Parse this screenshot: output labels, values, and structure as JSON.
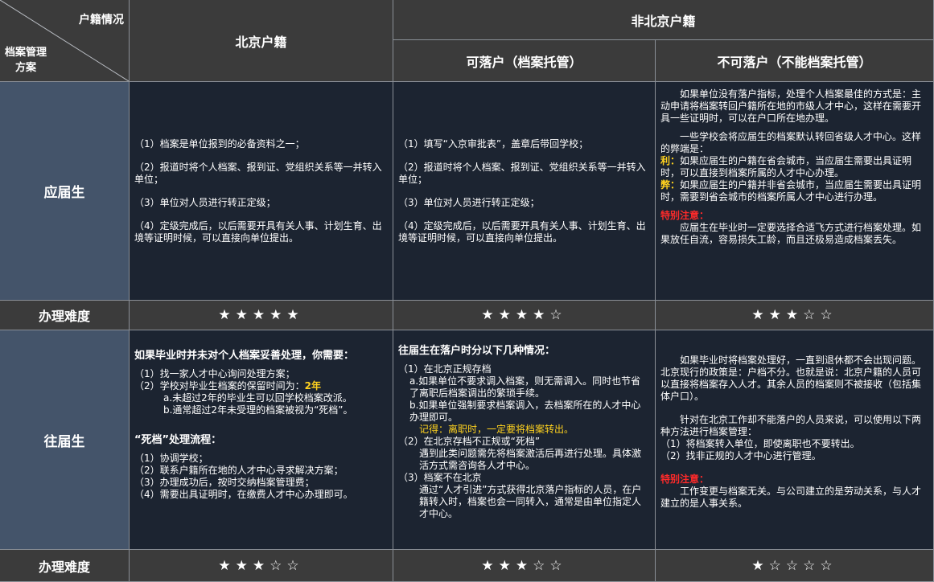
{
  "header": {
    "corner_top": "户籍情况",
    "corner_bottom": [
      "档案管理",
      "方案"
    ],
    "beijing": "北京户籍",
    "non_beijing": "非北京户籍",
    "settle": "可落户（档案托管）",
    "no_settle": "不可落户（不能档案托管）"
  },
  "rows": {
    "fresh_label": "应届生",
    "past_label": "往届生",
    "difficulty_label": "办理难度"
  },
  "fresh": {
    "beijing": [
      "（1）档案是单位报到的必备资料之一；",
      "（2）报道时将个人档案、报到证、党组织关系等一并转入单位；",
      "（3）单位对人员进行转正定级；",
      "（4）定级完成后，以后需要开具有关人事、计划生育、出境等证明时候，可以直接向单位提出。"
    ],
    "settle": [
      "（1）填写“入京审批表”，盖章后带回学校；",
      "（2）报道时将个人档案、报到证、党组织关系等一并转入单位；",
      "（3）单位对人员进行转正定级；",
      "（4）定级完成后，以后需要开具有关人事、计划生育、出境等证明时候，可以直接向单位提出。"
    ],
    "no_settle": {
      "p1": "如果单位没有落户指标，处理个人档案最佳的方式是：主动申请将档案转回户籍所在地的市级人才中心，这样在需要开具一些证明时，可以在户口所在地办理。",
      "p2": "一些学校会将应届生的档案默认转回省级人才中心。这样的弊端是：",
      "pro_label": "利：",
      "pro": "如果应届生的户籍在省会城市，当应届生需要出具证明时，可以直接到档案所属的人才中心办理。",
      "con_label": "弊：",
      "con": "如果应届生的户籍并非省会城市，当应届生需要出具证明时，需要到省会城市的档案所属人才中心进行办理。",
      "note_label": "特别注意：",
      "note": "应届生在毕业时一定要选择合适飞方式进行档案处理。如果放任自流，容易损失工龄，而且还极易造成档案丢失。"
    }
  },
  "past": {
    "beijing": {
      "title": "如果毕业时并未对个人档案妥善处理，你需要：",
      "i1": "（1）找一家人才中心询问处理方案；",
      "i2_pre": "（2）学校对毕业生档案的保留时间为：",
      "i2_val": "2年",
      "i2a": "a.未超过2年的毕业生可以回学校档案改派。",
      "i2b": "b.通常超过2年未受理的档案被视为“死档”。",
      "flow_title": "“死档”处理流程：",
      "f1": "（1）协调学校；",
      "f2": "（2）联系户籍所在地的人才中心寻求解决方案；",
      "f3": "（3）办理成功后，按时交纳档案管理费；",
      "f4": "（4）需要出具证明时，在缴费人才中心办理即可。"
    },
    "settle": {
      "title": "往届生在落户时分以下几种情况：",
      "s1": "（1）在北京正规存档",
      "s1a": "a.如果单位不要求调入档案，则无需调入。同时也节省了离职后档案调出的繁琐手续。",
      "s1b": "b.如果单位强制要求档案调入，去档案所在的人才中心办理即可。",
      "s1_note": "记得：离职时，一定要将档案转出。",
      "s2": "（2）在北京存档不正规或“死档”",
      "s2_text": "遇到此类问题需先将档案激活后再进行处理。具体激活方式需咨询各人才中心。",
      "s3": "（3）档案不在北京",
      "s3_text": "通过“人才引进”方式获得北京落户指标的人员，在户籍转入时，档案也会一同转入，通常是由单位指定人才中心。"
    },
    "no_settle": {
      "p1": "如果毕业时将档案处理好，一直到退休都不会出现问题。北京现行的政策是：户档不分。也就是说：北京户籍的人员可以直接将档案存入人才。其余人员的档案则不被接收（包括集体户口）。",
      "p2": "针对在北京工作却不能落户的人员来说，可以使用以下两种方法进行档案管理：",
      "m1": "（1）将档案转入单位，即使离职也不要转出。",
      "m2": "（2）找非正规的人才中心进行管理。",
      "note_label": "特别注意：",
      "note": "工作变更与档案无关。与公司建立的是劳动关系，与人才建立的是人事关系。"
    }
  },
  "difficulty": {
    "fresh": {
      "beijing": "★★★★★",
      "settle": "★★★★☆",
      "no_settle": "★★★☆☆"
    },
    "past": {
      "beijing": "★★★☆☆",
      "settle": "★★★☆☆",
      "no_settle": "★☆☆☆☆"
    }
  }
}
